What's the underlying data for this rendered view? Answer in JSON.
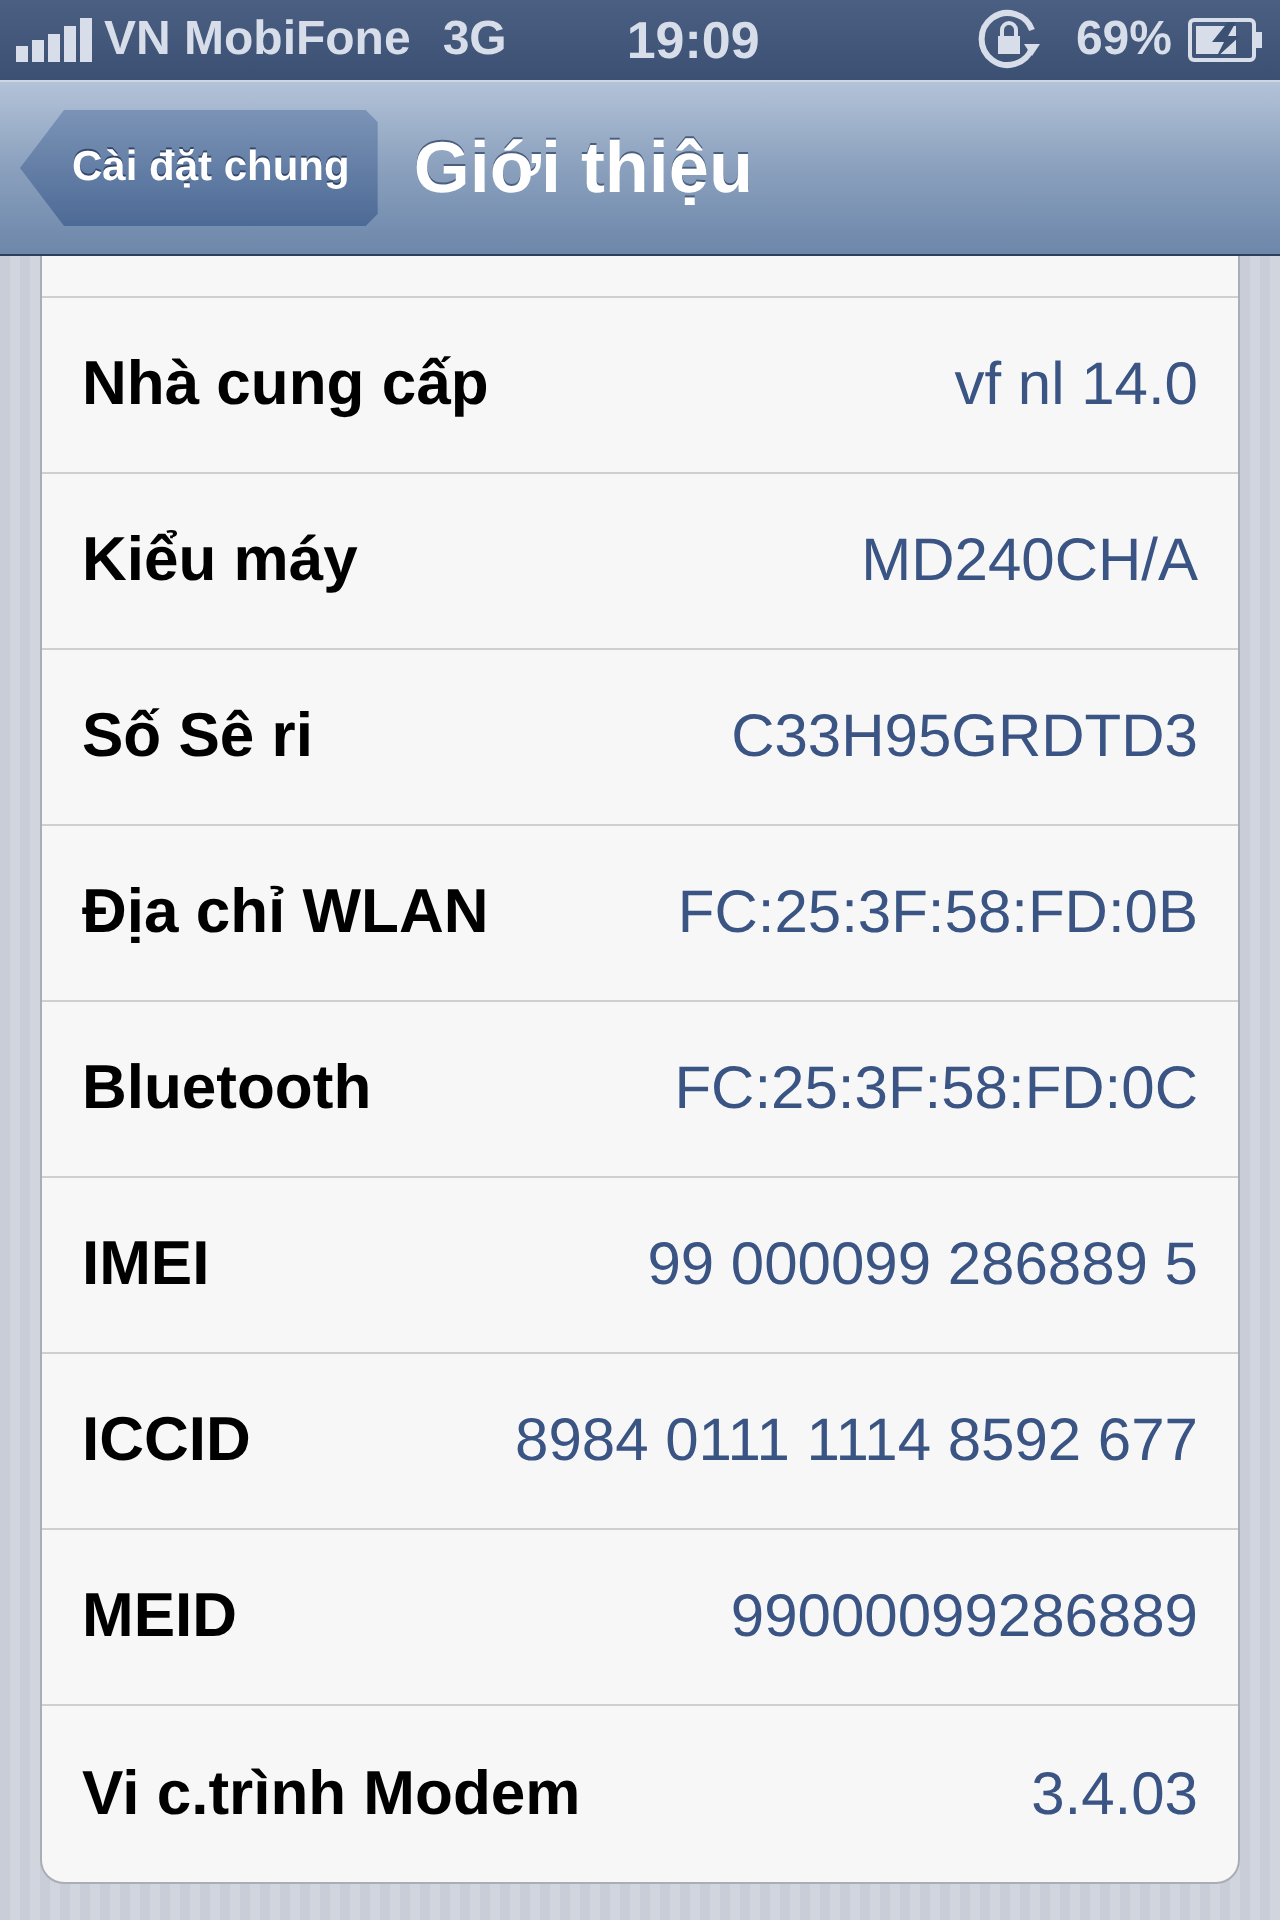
{
  "status_bar": {
    "carrier": "VN MobiFone",
    "network": "3G",
    "time": "19:09",
    "battery": "69%"
  },
  "nav_bar": {
    "back_button": "Cài đặt chung",
    "title": "Giới thiệu"
  },
  "rows": [
    {
      "label": "Nhà cung cấp",
      "value": "vf nl 14.0"
    },
    {
      "label": "Kiểu máy",
      "value": "MD240CH/A"
    },
    {
      "label": "Số Sê ri",
      "value": "C33H95GRDTD3"
    },
    {
      "label": "Địa chỉ WLAN",
      "value": "FC:25:3F:58:FD:0B"
    },
    {
      "label": "Bluetooth",
      "value": "FC:25:3F:58:FD:0C"
    },
    {
      "label": "IMEI",
      "value": "99 000099 286889 5"
    },
    {
      "label": "ICCID",
      "value": "8984 0111 1114 8592 677"
    },
    {
      "label": "MEID",
      "value": "99000099286889"
    },
    {
      "label": "Vi c.trình Modem",
      "value": "3.4.03"
    }
  ]
}
